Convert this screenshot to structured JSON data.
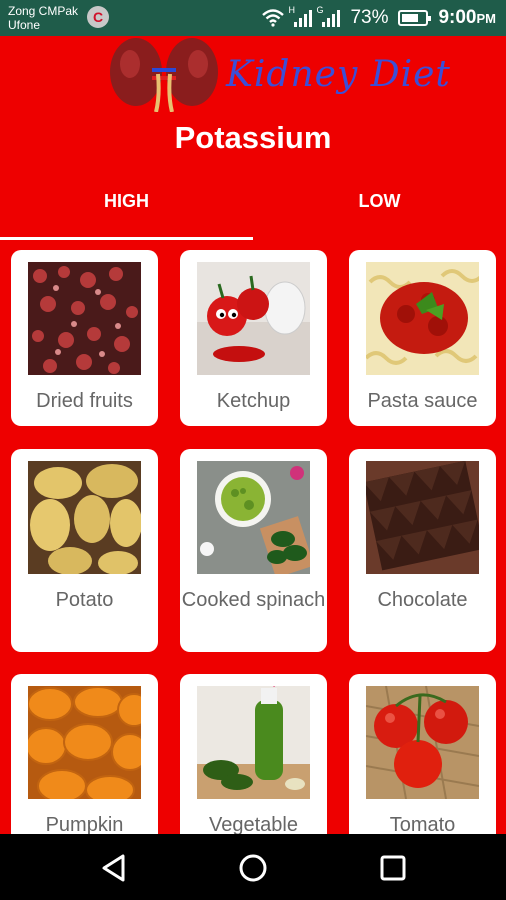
{
  "status": {
    "carrier_line1": "Zong CMPak",
    "carrier_line2": "Ufone",
    "carrier_badge": "C",
    "sim1_label": "H",
    "sim2_label": "G",
    "battery_percent": "73%",
    "battery_level": 0.73,
    "time": "9:00",
    "time_suffix": "PM"
  },
  "header": {
    "app_title": "Kidney Diet",
    "page_title": "Potassium"
  },
  "tabs": [
    {
      "label": "HIGH",
      "selected": true
    },
    {
      "label": "LOW",
      "selected": false
    }
  ],
  "foods": [
    {
      "label": "Dried fruits",
      "icon": "dried-fruits-image"
    },
    {
      "label": "Ketchup",
      "icon": "ketchup-image"
    },
    {
      "label": "Pasta sauce",
      "icon": "pasta-sauce-image"
    },
    {
      "label": "Potato",
      "icon": "potato-image"
    },
    {
      "label": "Cooked spinach",
      "icon": "cooked-spinach-image"
    },
    {
      "label": "Chocolate",
      "icon": "chocolate-image"
    },
    {
      "label": "Pumpkin",
      "icon": "pumpkin-image"
    },
    {
      "label": "Vegetable",
      "icon": "vegetable-juice-image"
    },
    {
      "label": "Tomato",
      "icon": "tomato-image"
    }
  ],
  "colors": {
    "background": "#ee0000",
    "status_bar": "#1f5c4a",
    "app_title": "#3b4fd8",
    "label": "#666666"
  }
}
